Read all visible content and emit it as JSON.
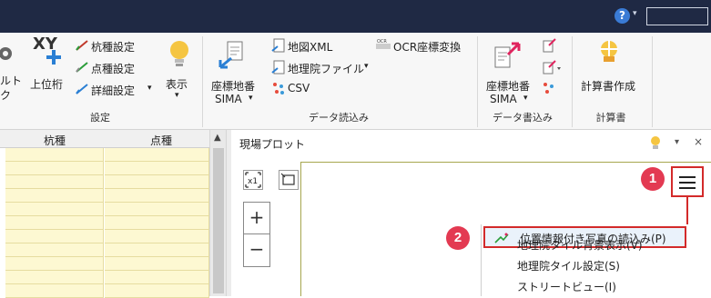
{
  "topbar": {
    "help_label": "?",
    "help_caret": "▾"
  },
  "ribbon": {
    "left_partial": {
      "line1": "ルト",
      "line2": "ク"
    },
    "upper_digit": {
      "top": "XY",
      "label": "上位桁"
    },
    "settings_items": [
      "杭種設定",
      "点種設定",
      "詳細設定"
    ],
    "display_label": "表示",
    "group_settings": "設定",
    "import_sima": {
      "line1": "座標地番",
      "line2": "SIMA"
    },
    "import_items": [
      "地図XML",
      "地理院ファイル",
      "CSV"
    ],
    "ocr_label": "OCR座標変換",
    "group_import": "データ読込み",
    "export_sima": {
      "line1": "座標地番",
      "line2": "SIMA"
    },
    "group_export": "データ書込み",
    "calc_label": "計算書作成",
    "group_calc": "計算書",
    "dropdown_caret": "▾"
  },
  "grid": {
    "headers": [
      "杭種",
      "点種"
    ],
    "scroll_up": "▲"
  },
  "plot": {
    "title": "現場プロット",
    "caret": "▾",
    "close": "×",
    "zoom_plus": "+",
    "zoom_minus": "−",
    "scale_label": "x1"
  },
  "menu": {
    "highlighted_item": "位置情報付き写真の読込み(P)",
    "items": [
      "地理院タイル背景表示(V)",
      "地理院タイル設定(S)",
      "ストリートビュー(I)"
    ]
  },
  "annotations": {
    "badge1": "1",
    "badge2": "2"
  },
  "colors": {
    "topbar": "#1f2944",
    "highlight_red": "#d32a2a",
    "badge": "#e33a52",
    "grid_row": "#fdf8d2"
  }
}
